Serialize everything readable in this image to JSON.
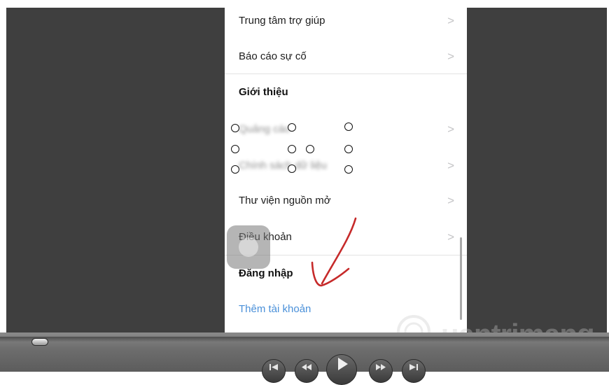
{
  "menu": {
    "items": [
      {
        "label": "Trung tâm trợ giúp",
        "chevron": ">"
      },
      {
        "label": "Báo cáo sự cố",
        "chevron": ">"
      },
      {
        "label": "Giới thiệu"
      },
      {
        "label": "Quảng cáo",
        "chevron": ">"
      },
      {
        "label": "Chính sách dữ liệu",
        "chevron": ">"
      },
      {
        "label": "Thư viện nguồn mở",
        "chevron": ">"
      },
      {
        "label": "Điều khoản",
        "chevron": ">"
      },
      {
        "label": "Đăng nhập"
      },
      {
        "label": "Thêm tài khoản"
      }
    ]
  },
  "watermark": {
    "text": "uantrimang"
  },
  "colors": {
    "link": "#4a90d9",
    "annotation": "#c62a2a",
    "video_background": "#3f3f3f"
  },
  "icons": {
    "chevron": "chevron-right-icon",
    "skip_back": "skip-back-icon",
    "rewind": "rewind-icon",
    "play": "play-icon",
    "fast_forward": "fast-forward-icon",
    "skip_forward": "skip-forward-icon"
  }
}
